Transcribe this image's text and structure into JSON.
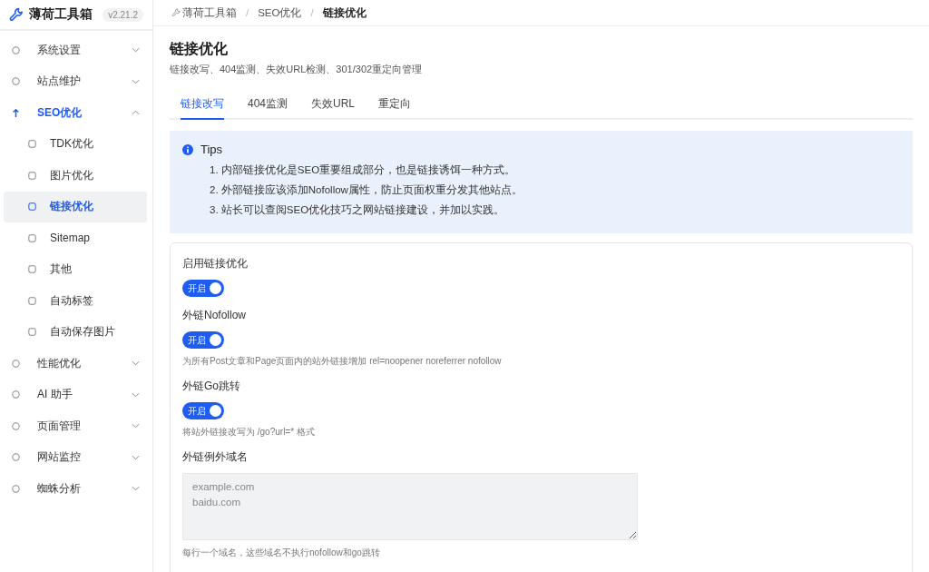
{
  "app": {
    "name": "薄荷工具箱",
    "version": "v2.21.2"
  },
  "sidebar": {
    "items": [
      {
        "label": "系统设置",
        "expanded": false,
        "selected": false
      },
      {
        "label": "站点维护",
        "expanded": false,
        "selected": false
      },
      {
        "label": "SEO优化",
        "expanded": true,
        "selected": true,
        "children": [
          {
            "label": "TDK优化",
            "selected": false
          },
          {
            "label": "图片优化",
            "selected": false
          },
          {
            "label": "链接优化",
            "selected": true
          },
          {
            "label": "Sitemap",
            "selected": false
          },
          {
            "label": "其他",
            "selected": false
          },
          {
            "label": "自动标签",
            "selected": false
          },
          {
            "label": "自动保存图片",
            "selected": false
          }
        ]
      },
      {
        "label": "性能优化",
        "expanded": false,
        "selected": false
      },
      {
        "label": "AI 助手",
        "expanded": false,
        "selected": false
      },
      {
        "label": "页面管理",
        "expanded": false,
        "selected": false
      },
      {
        "label": "网站监控",
        "expanded": false,
        "selected": false
      },
      {
        "label": "蜘蛛分析",
        "expanded": false,
        "selected": false
      }
    ]
  },
  "breadcrumb": {
    "separator": "/",
    "items": [
      "薄荷工具箱",
      "SEO优化",
      "链接优化"
    ]
  },
  "page": {
    "title": "链接优化",
    "subtitle": "链接改写、404监测、失效URL检测、301/302重定向管理"
  },
  "tabs": [
    {
      "label": "链接改写",
      "selected": true
    },
    {
      "label": "404监测",
      "selected": false
    },
    {
      "label": "失效URL",
      "selected": false
    },
    {
      "label": "重定向",
      "selected": false
    }
  ],
  "tips": {
    "title": "Tips",
    "lines": [
      "1. 内部链接优化是SEO重要组成部分，也是链接诱饵一种方式。",
      "2. 外部链接应该添加Nofollow属性，防止页面权重分发其他站点。",
      "3. 站长可以查阅SEO优化技巧之网站链接建设，并加以实践。"
    ]
  },
  "settings": [
    {
      "kind": "switch",
      "label": "启用链接优化",
      "on": true,
      "switch_text": "开启"
    },
    {
      "kind": "switch",
      "label": "外链Nofollow",
      "on": true,
      "switch_text": "开启",
      "help": "为所有Post文章和Page页面内的站外链接增加 rel=noopener noreferrer nofollow"
    },
    {
      "kind": "switch",
      "label": "外链Go跳转",
      "on": true,
      "switch_text": "开启",
      "help": "将站外链接改写为 /go?url=* 格式"
    },
    {
      "kind": "textarea",
      "label": "外链例外域名",
      "placeholder": "example.com\nbaidu.com",
      "help": "每行一个域名，这些域名不执行nofollow和go跳转"
    }
  ]
}
